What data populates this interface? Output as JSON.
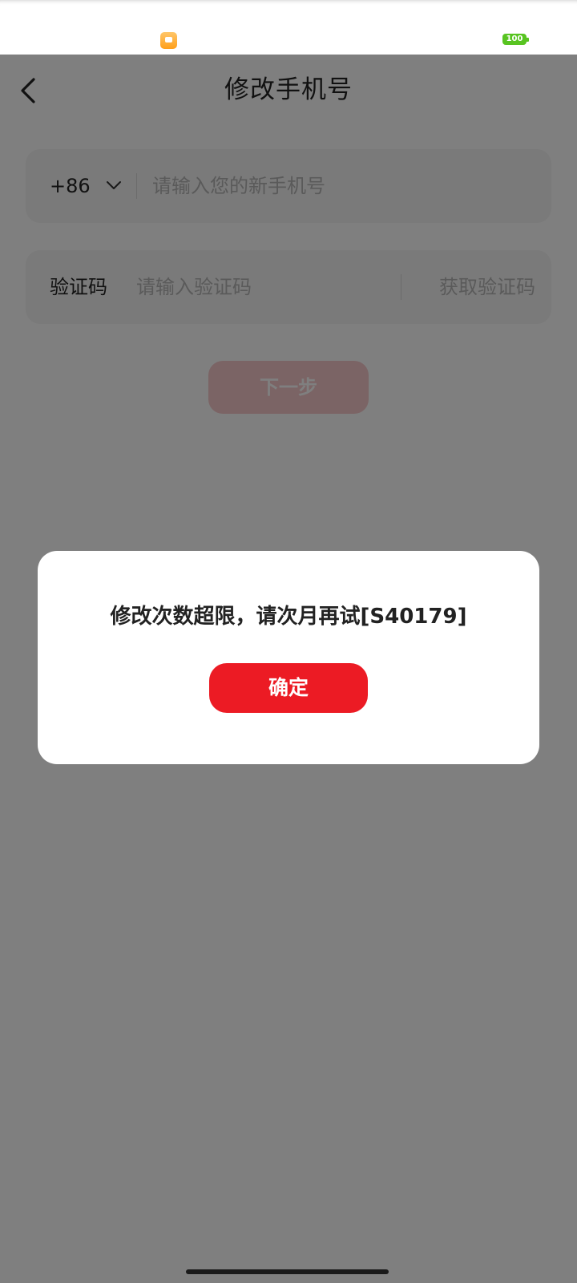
{
  "status_bar": {
    "app_icon": "notes-app-icon",
    "battery_level": "100",
    "battery_color": "#58c421"
  },
  "header": {
    "back_icon": "chevron-left-icon",
    "title": "修改手机号"
  },
  "phone_row": {
    "country_code": "+86",
    "chevron_icon": "chevron-down-icon",
    "placeholder": "请输入您的新手机号",
    "value": ""
  },
  "code_row": {
    "label": "验证码",
    "placeholder": "请输入验证码",
    "value": "",
    "get_code_label": "获取验证码"
  },
  "next_button": {
    "label": "下一步",
    "color": "#f7c9ca"
  },
  "dialog": {
    "message": "修改次数超限，请次月再试[S40179]",
    "confirm_label": "确定",
    "confirm_color": "#ec1b24"
  }
}
